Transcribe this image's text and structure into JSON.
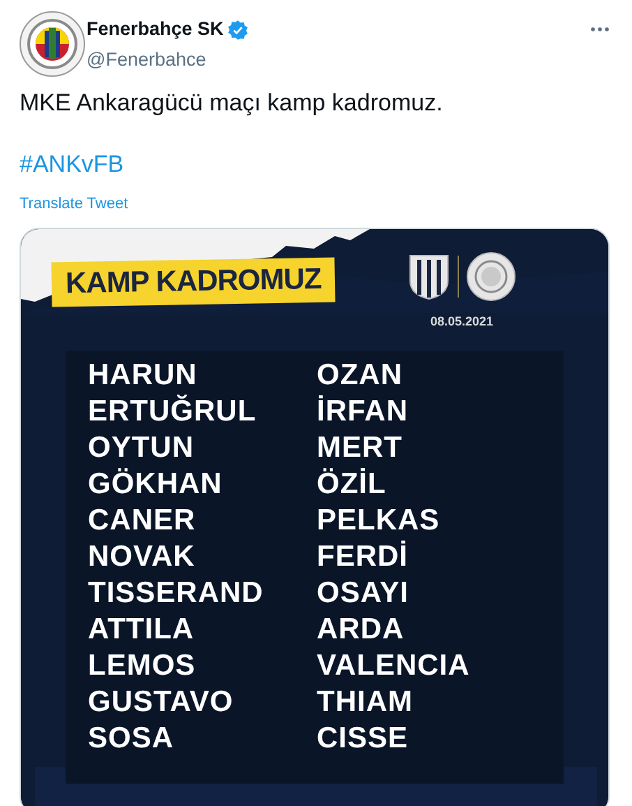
{
  "account": {
    "name": "Fenerbahçe SK",
    "handle": "@Fenerbahce",
    "verified": true
  },
  "text": "MKE Ankaragücü maçı kamp kadromuz.",
  "hashtag": "#ANKvFB",
  "translate": "Translate Tweet",
  "image": {
    "banner": "KAMP KADROMUZ",
    "date": "08.05.2021",
    "columns": [
      [
        "HARUN",
        "ERTUĞRUL",
        "OYTUN",
        "GÖKHAN",
        "CANER",
        "NOVAK",
        "TISSERAND",
        "ATTILA",
        "LEMOS",
        "GUSTAVO",
        "SOSA"
      ],
      [
        "OZAN",
        "İRFAN",
        "MERT",
        "ÖZİL",
        "PELKAS",
        "FERDİ",
        "OSAYI",
        "ARDA",
        "VALENCIA",
        "THIAM",
        "CISSE"
      ]
    ]
  }
}
